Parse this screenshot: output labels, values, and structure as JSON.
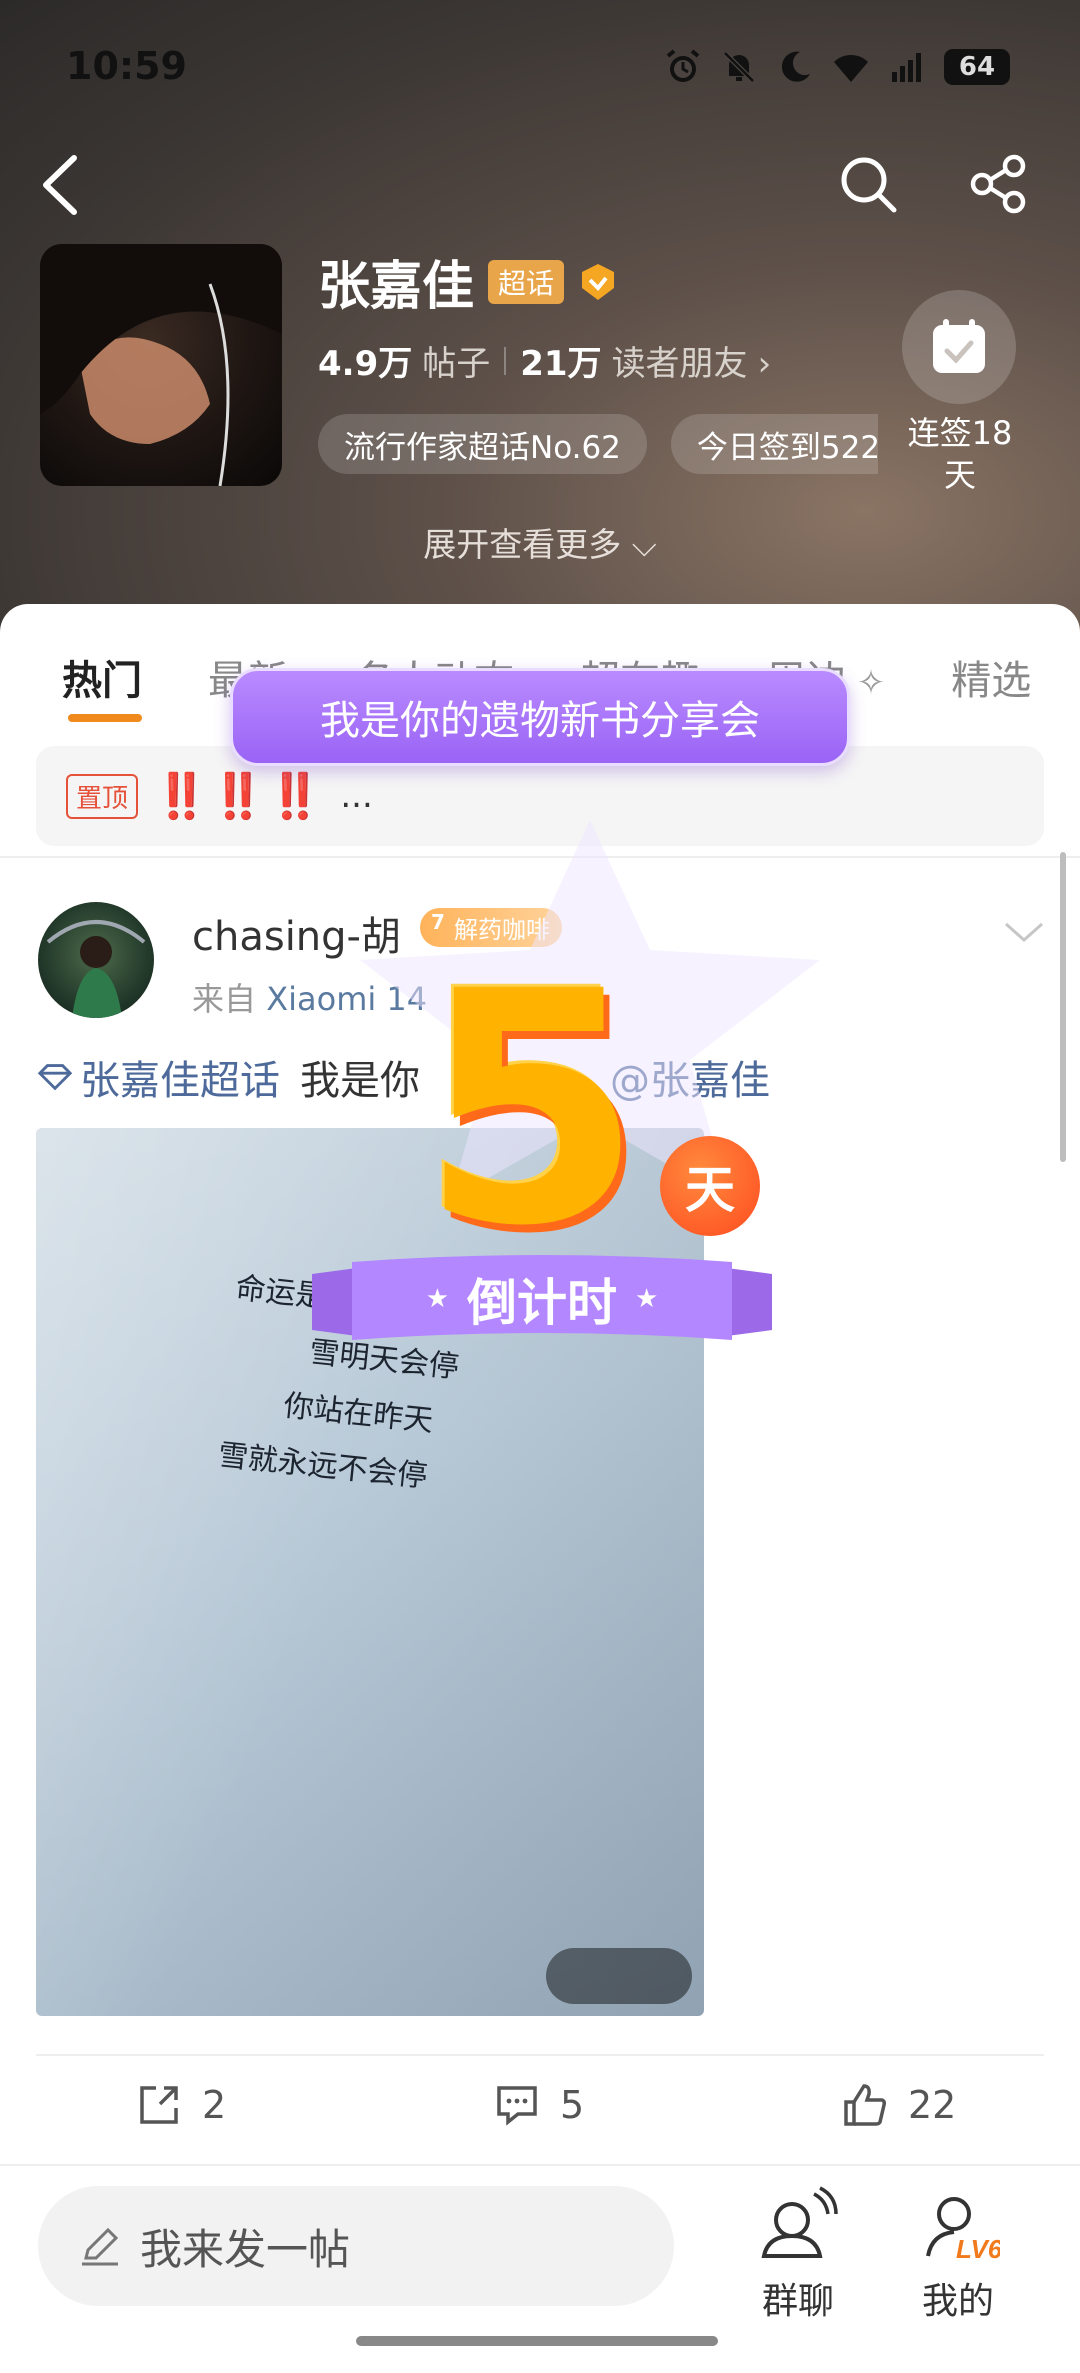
{
  "status_bar": {
    "time": "10:59",
    "battery": "64"
  },
  "header": {
    "title": "张嘉佳",
    "chaohua_badge": "超话",
    "stats": {
      "posts_count": "4.9万",
      "posts_label": "帖子",
      "readers_count": "21万",
      "readers_label": "读者朋友"
    },
    "chips": [
      "流行作家超话No.62",
      "今日签到522"
    ],
    "checkin_label": "连签18天",
    "expand_label": "展开查看更多"
  },
  "tabs": [
    "热门",
    "最新",
    "名人动态",
    "超有趣",
    "周边",
    "精选"
  ],
  "pinned": {
    "badge": "置顶",
    "text": "‼️‼️‼️",
    "ellipsis": "..."
  },
  "overlay": {
    "share_banner": "我是你的遗物新书分享会",
    "countdown_number": "5",
    "countdown_unit": "天",
    "countdown_ribbon": "倒计时"
  },
  "post": {
    "author": "chasing-胡",
    "badge_level": "7",
    "badge_label": "解药咖啡",
    "source_prefix": "来自",
    "source_device": "Xiaomi 14",
    "topic": "张嘉佳超话",
    "text": "我是你",
    "mention": "@张嘉佳",
    "poem": [
      "命运是原封不动的",
      "雪明天会停",
      "你站在昨天",
      "雪就永远不会停"
    ],
    "actions": {
      "share": "2",
      "comment": "5",
      "like": "22"
    }
  },
  "bottom_bar": {
    "compose_placeholder": "我来发一帖",
    "group_chat": "群聊",
    "mine": "我的",
    "level_badge": "LV6"
  },
  "colors": {
    "accent": "#f08a1c",
    "purple": "#9a63f5",
    "topic_blue": "#4d6a9a"
  }
}
